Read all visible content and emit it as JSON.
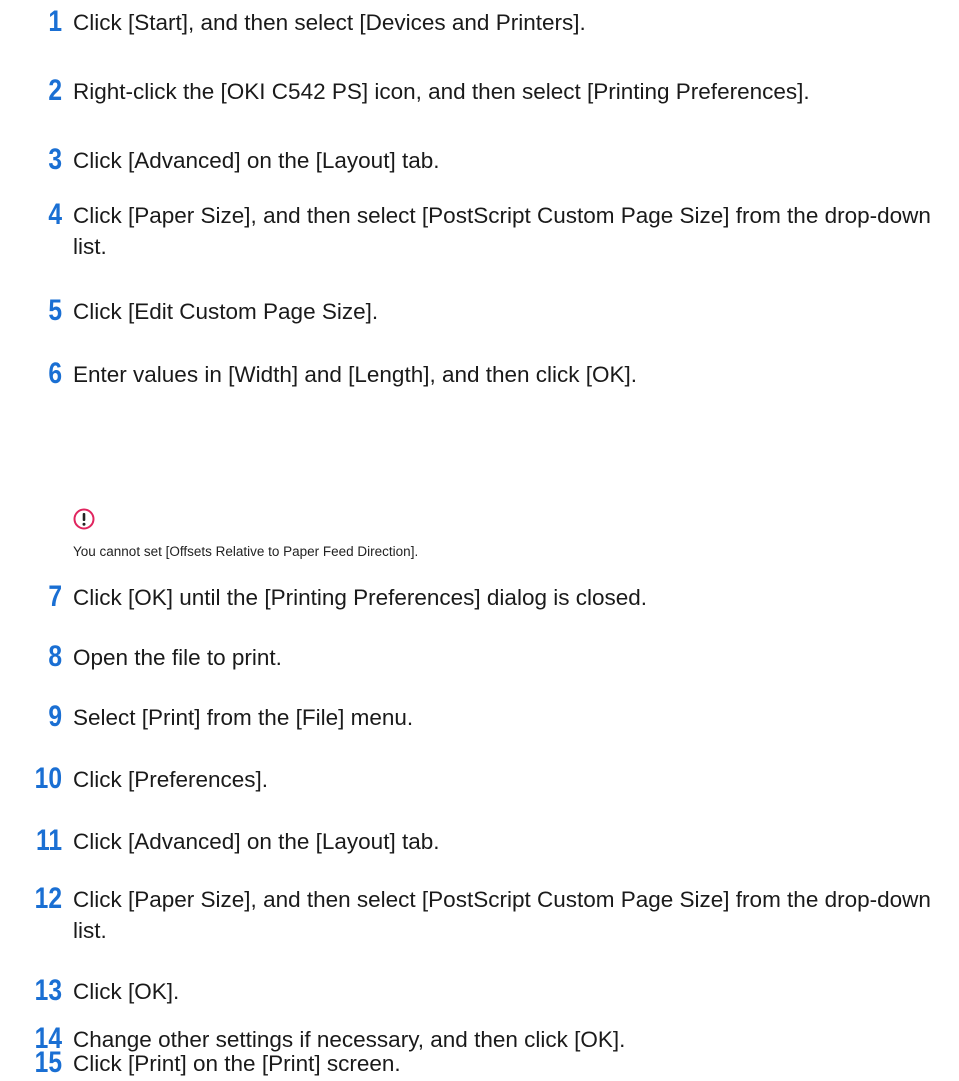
{
  "steps": [
    {
      "num": "1",
      "text": "Click [Start], and then select [Devices and Printers]."
    },
    {
      "num": "2",
      "text": "Right-click the [OKI C542 PS] icon, and then select [Printing Preferences]."
    },
    {
      "num": "3",
      "text": "Click [Advanced] on the [Layout] tab."
    },
    {
      "num": "4",
      "text": "Click [Paper Size], and then select [PostScript Custom Page Size] from the drop-down list."
    },
    {
      "num": "5",
      "text": "Click [Edit Custom Page Size]."
    },
    {
      "num": "6",
      "text": "Enter values in [Width] and [Length], and then click [OK]."
    },
    {
      "num": "7",
      "text": "Click [OK] until the [Printing Preferences] dialog is closed."
    },
    {
      "num": "8",
      "text": "Open the file to print."
    },
    {
      "num": "9",
      "text": "Select [Print] from the [File] menu."
    },
    {
      "num": "10",
      "text": "Click [Preferences]."
    },
    {
      "num": "11",
      "text": "Click [Advanced] on the [Layout] tab."
    },
    {
      "num": "12",
      "text": "Click [Paper Size], and then select [PostScript Custom Page Size] from the drop-down list."
    },
    {
      "num": "13",
      "text": "Click [OK]."
    },
    {
      "num": "14",
      "text": "Change other settings if necessary, and then click [OK]."
    },
    {
      "num": "15",
      "text": "Click [Print] on the [Print] screen."
    }
  ],
  "note": {
    "icon": "caution-icon",
    "icon_color": "#e0245e",
    "text": "You cannot set [Offsets Relative to Paper Feed Direction]."
  },
  "colors": {
    "step_number": "#1a6fd3",
    "body_text": "#1a1a1a"
  }
}
